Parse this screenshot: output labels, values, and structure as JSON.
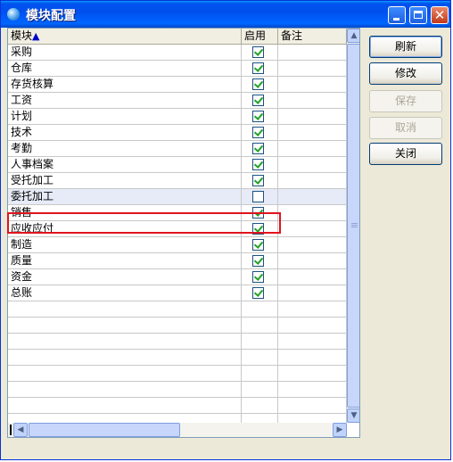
{
  "window": {
    "title": "模块配置"
  },
  "grid": {
    "columns": [
      {
        "label": "模块",
        "sort_indicator": "▲"
      },
      {
        "label": "启用"
      },
      {
        "label": "备注"
      }
    ],
    "rows": [
      {
        "name": "采购",
        "enabled": true,
        "note": ""
      },
      {
        "name": "仓库",
        "enabled": true,
        "note": ""
      },
      {
        "name": "存货核算",
        "enabled": true,
        "note": ""
      },
      {
        "name": "工资",
        "enabled": true,
        "note": ""
      },
      {
        "name": "计划",
        "enabled": true,
        "note": ""
      },
      {
        "name": "技术",
        "enabled": true,
        "note": ""
      },
      {
        "name": "考勤",
        "enabled": true,
        "note": ""
      },
      {
        "name": "人事档案",
        "enabled": true,
        "note": ""
      },
      {
        "name": "受托加工",
        "enabled": true,
        "note": ""
      },
      {
        "name": "委托加工",
        "enabled": false,
        "note": "",
        "selected": true
      },
      {
        "name": "销售",
        "enabled": true,
        "note": ""
      },
      {
        "name": "应收应付",
        "enabled": true,
        "note": ""
      },
      {
        "name": "制造",
        "enabled": true,
        "note": ""
      },
      {
        "name": "质量",
        "enabled": true,
        "note": ""
      },
      {
        "name": "资金",
        "enabled": true,
        "note": ""
      },
      {
        "name": "总账",
        "enabled": true,
        "note": ""
      }
    ],
    "empty_rows": 8
  },
  "buttons": {
    "refresh": "刷新",
    "modify": "修改",
    "save": "保存",
    "cancel": "取消",
    "close": "关闭"
  },
  "colors": {
    "highlight": "#e0141e",
    "titlebar": "#0053ee"
  }
}
